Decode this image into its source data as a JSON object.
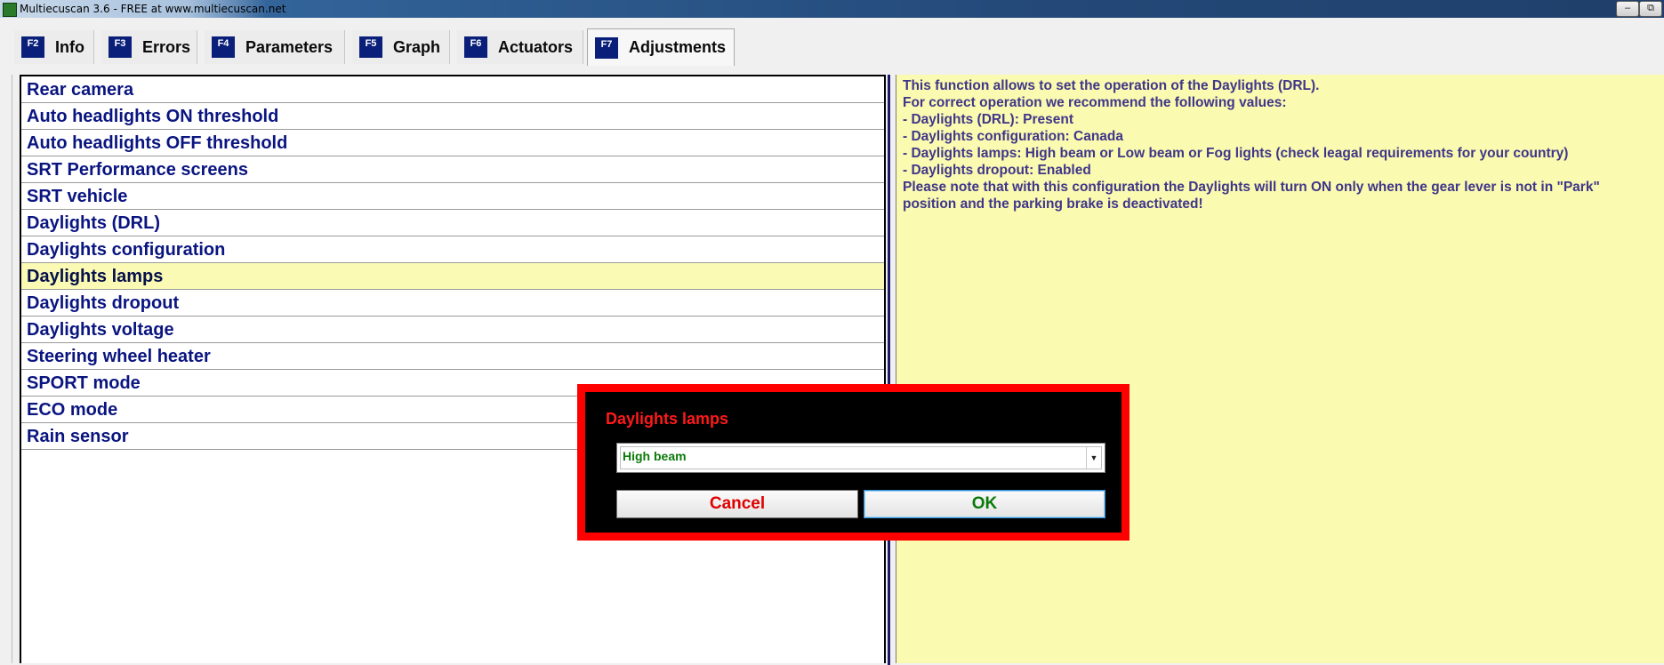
{
  "window": {
    "title": "Multiecuscan 3.6 - FREE at www.multiecuscan.net",
    "minimize": "–",
    "restore": "⧉"
  },
  "tabs": [
    {
      "key": "F2",
      "label": "Info"
    },
    {
      "key": "F3",
      "label": "Errors"
    },
    {
      "key": "F4",
      "label": "Parameters"
    },
    {
      "key": "F5",
      "label": "Graph"
    },
    {
      "key": "F6",
      "label": "Actuators"
    },
    {
      "key": "F7",
      "label": "Adjustments",
      "active": true
    }
  ],
  "adjustments": [
    "Rear camera",
    "Auto headlights ON threshold",
    "Auto headlights OFF threshold",
    "SRT Performance screens",
    "SRT vehicle",
    "Daylights (DRL)",
    "Daylights configuration",
    "Daylights lamps",
    "Daylights dropout",
    "Daylights voltage",
    "Steering wheel heater",
    "SPORT mode",
    "ECO mode",
    "Rain sensor"
  ],
  "selected_adjustment": "Daylights lamps",
  "info_lines": [
    "This function allows to set the operation of the Daylights (DRL).",
    "For correct operation we recommend the following values:",
    "- Daylights (DRL): Present",
    "- Daylights configuration: Canada",
    "- Daylights lamps: High beam or Low beam or Fog lights (check leagal requirements for your country)",
    "- Daylights dropout: Enabled",
    "Please note that with this configuration the Daylights will turn ON only when the gear lever is not in \"Park\"",
    "position and the parking brake is deactivated!"
  ],
  "dialog": {
    "title": "Daylights lamps",
    "selected_value": "High beam",
    "cancel_label": "Cancel",
    "ok_label": "OK"
  },
  "colors": {
    "list_text": "#0a1580",
    "selected_row": "#fafab4",
    "info_bg": "#fafab0",
    "info_text": "#40368a",
    "dialog_border": "#ff0000",
    "dialog_title": "#ff1a1a",
    "ok_text": "#0a7a0a",
    "cancel_text": "#e00000"
  }
}
